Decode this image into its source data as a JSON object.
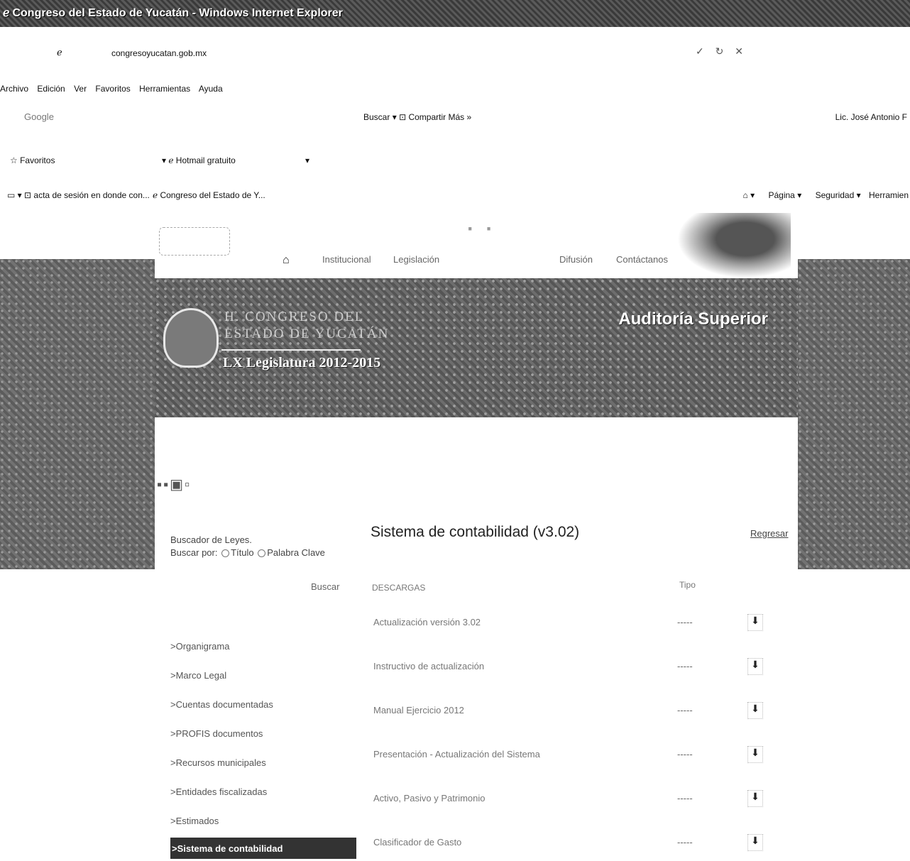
{
  "window": {
    "title": "Congreso del Estado de Yucatán - Windows Internet Explorer"
  },
  "address": {
    "url": "congresoyucatan.gob.mx"
  },
  "menubar": {
    "items": [
      "Archivo",
      "Edición",
      "Ver",
      "Favoritos",
      "Herramientas",
      "Ayuda"
    ]
  },
  "googlebar": {
    "logo": "Google",
    "buscar": "Buscar",
    "compartir": "Compartir",
    "mas": "Más »",
    "user": "Lic. José Antonio F"
  },
  "favbar": {
    "favoritos": "Favoritos",
    "hotmail": "Hotmail gratuito"
  },
  "tabs": [
    {
      "label": "acta de sesión en donde con..."
    },
    {
      "label": "Congreso del Estado de Y..."
    }
  ],
  "commandbar": {
    "pagina": "Página",
    "seguridad": "Seguridad",
    "herramientas": "Herramien"
  },
  "site": {
    "nav": {
      "institucional": "Institucional",
      "legislacion": "Legislación",
      "difusion": "Difusión",
      "contactanos": "Contáctanos"
    },
    "banner": {
      "org_line1": "H. CONGRESO DEL",
      "org_line2": "ESTADO DE YUCATÁN",
      "legislatura": "LX Legislatura 2012-2015",
      "section": "Auditoría Superior"
    }
  },
  "sidebar": {
    "search_label": "Buscador de Leyes.",
    "search_by": "Buscar por:",
    "option_titulo": "Título",
    "option_palabra": "Palabra Clave",
    "search_button": "Buscar",
    "items": [
      {
        "label": ">Organigrama"
      },
      {
        "label": ">Marco Legal"
      },
      {
        "label": ">Cuentas documentadas"
      },
      {
        "label": ">PROFIS documentos"
      },
      {
        "label": ">Recursos municipales"
      },
      {
        "label": ">Entidades fiscalizadas"
      },
      {
        "label": ">Estimados"
      },
      {
        "label": ">Sistema de contabilidad"
      }
    ]
  },
  "main": {
    "title": "Sistema de contabilidad (v3.02)",
    "back": "Regresar",
    "table": {
      "headers": [
        "DESCARGAS",
        "Tipo"
      ],
      "rows": [
        {
          "desc": "Actualización versión 3.02",
          "dash": "-----"
        },
        {
          "desc": "Instructivo de actualización",
          "dash": "-----"
        },
        {
          "desc": "Manual Ejercicio 2012",
          "dash": "-----"
        },
        {
          "desc": "Presentación - Actualización del Sistema",
          "dash": "-----"
        },
        {
          "desc": "Activo, Pasivo y Patrimonio",
          "dash": "-----"
        },
        {
          "desc": "Clasificador de Gasto",
          "dash": "-----"
        }
      ]
    }
  }
}
